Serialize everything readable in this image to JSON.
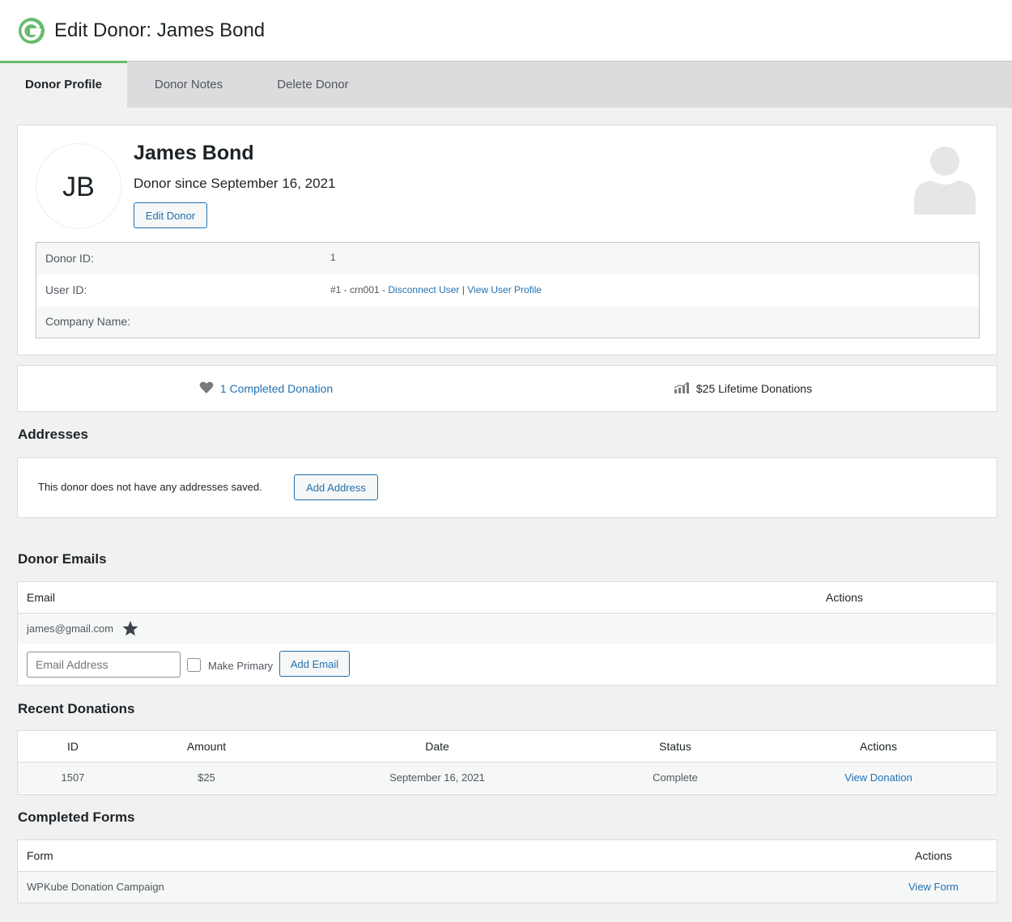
{
  "header": {
    "title": "Edit Donor: James Bond"
  },
  "tabs": [
    {
      "label": "Donor Profile",
      "active": true
    },
    {
      "label": "Donor Notes",
      "active": false
    },
    {
      "label": "Delete Donor",
      "active": false
    }
  ],
  "profile": {
    "initials": "JB",
    "name": "James Bond",
    "since": "Donor since September 16, 2021",
    "edit_button": "Edit Donor",
    "fields": {
      "donor_id_label": "Donor ID:",
      "donor_id_value": "1",
      "user_id_label": "User ID:",
      "user_id_value": "#1 - crn001 -",
      "disconnect_link": "Disconnect User",
      "separator": "|",
      "view_profile_link": "View User Profile",
      "company_label": "Company Name:",
      "company_value": ""
    }
  },
  "stats": {
    "completed": "1 Completed Donation",
    "lifetime": "$25 Lifetime Donations"
  },
  "addresses": {
    "title": "Addresses",
    "empty_text": "This donor does not have any addresses saved.",
    "add_button": "Add Address"
  },
  "emails": {
    "title": "Donor Emails",
    "col_email": "Email",
    "col_actions": "Actions",
    "rows": [
      {
        "email": "james@gmail.com",
        "primary": true
      }
    ],
    "input_placeholder": "Email Address",
    "make_primary_label": "Make Primary",
    "add_button": "Add Email"
  },
  "donations": {
    "title": "Recent Donations",
    "columns": {
      "id": "ID",
      "amount": "Amount",
      "date": "Date",
      "status": "Status",
      "actions": "Actions"
    },
    "rows": [
      {
        "id": "1507",
        "amount": "$25",
        "date": "September 16, 2021",
        "status": "Complete",
        "action": "View Donation"
      }
    ]
  },
  "forms": {
    "title": "Completed Forms",
    "col_form": "Form",
    "col_actions": "Actions",
    "rows": [
      {
        "form": "WPKube Donation Campaign",
        "action": "View Form"
      }
    ]
  },
  "colors": {
    "accent": "#2271b1",
    "tab_indicator": "#66bb6a",
    "logo": "#66bb6a"
  },
  "icons": [
    "give-logo-icon",
    "user-silhouette-icon",
    "heart-icon",
    "chart-icon",
    "star-icon"
  ]
}
